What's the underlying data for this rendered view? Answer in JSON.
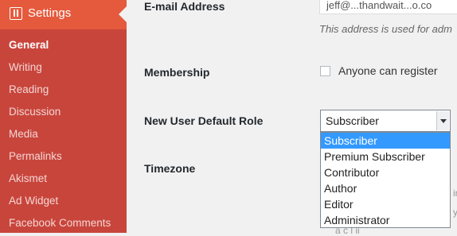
{
  "sidebar": {
    "header": {
      "label": "Settings",
      "icon": "settings-icon"
    },
    "items": [
      {
        "label": "General",
        "current": true
      },
      {
        "label": "Writing"
      },
      {
        "label": "Reading"
      },
      {
        "label": "Discussion"
      },
      {
        "label": "Media"
      },
      {
        "label": "Permalinks"
      },
      {
        "label": "Akismet"
      },
      {
        "label": "Ad Widget"
      },
      {
        "label": "Facebook Comments"
      }
    ]
  },
  "form": {
    "email": {
      "label": "E-mail Address",
      "value": "jeff@...thandwait...o.co",
      "description": "This address is used for adm"
    },
    "membership": {
      "label": "Membership",
      "checkbox_label": "Anyone can register",
      "checked": false
    },
    "default_role": {
      "label": "New User Default Role",
      "selected": "Subscriber",
      "options": [
        "Subscriber",
        "Premium Subscriber",
        "Contributor",
        "Author",
        "Editor",
        "Administrator"
      ]
    },
    "timezone": {
      "label": "Timezone",
      "fragments": [
        "ir",
        "y",
        "a c l ii"
      ]
    }
  },
  "colors": {
    "sidebar_bg": "#c8453c",
    "header_bg": "#e55a3d",
    "highlight": "#3399ff"
  }
}
